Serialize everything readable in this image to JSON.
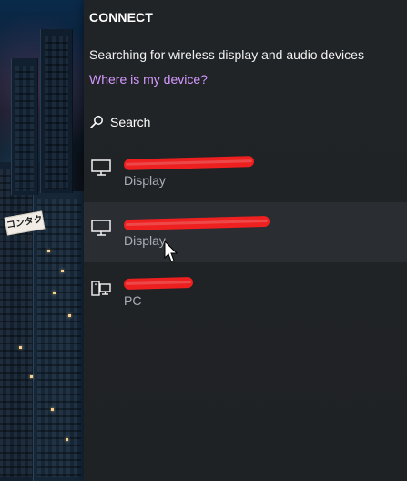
{
  "panel": {
    "title": "CONNECT",
    "status_text": "Searching for wireless display and audio devices",
    "help_link": "Where is my device?",
    "search_label": "Search"
  },
  "devices": [
    {
      "name": "",
      "type": "Display",
      "icon": "monitor-icon",
      "selected": false
    },
    {
      "name": "",
      "type": "Display",
      "icon": "monitor-icon",
      "selected": true
    },
    {
      "name": "",
      "type": "PC",
      "icon": "pc-icon",
      "selected": false
    }
  ],
  "background": {
    "sign_text": "コンタクト"
  },
  "colors": {
    "panel_bg": "#212427",
    "selected_bg": "#2a2d31",
    "link": "#d699ff",
    "redaction": "#ff1f1f"
  }
}
